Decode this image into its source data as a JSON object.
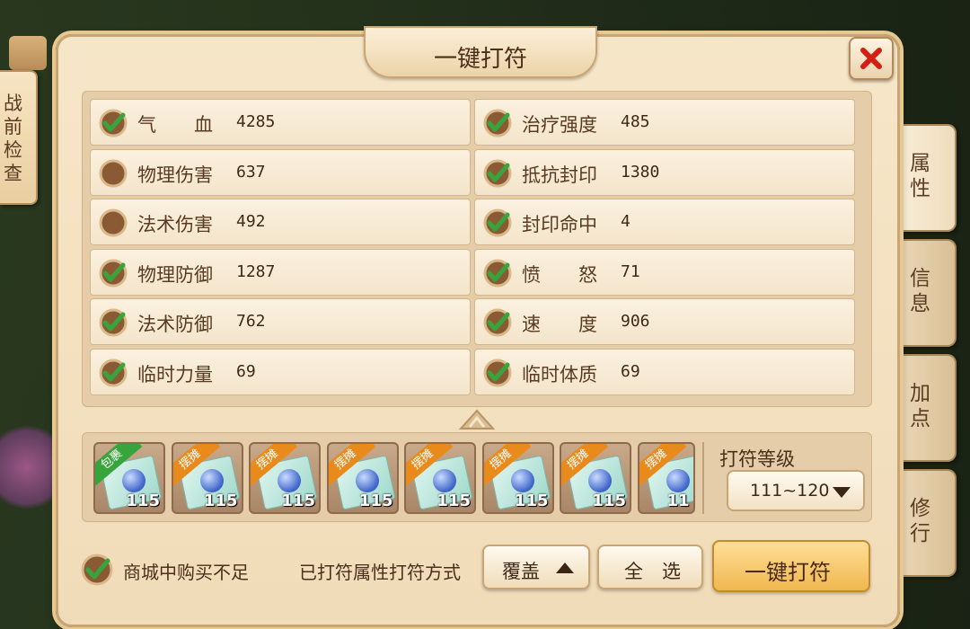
{
  "left_tab": {
    "label": "战前检查"
  },
  "right_tabs": [
    {
      "label": "属性"
    },
    {
      "label": "信息"
    },
    {
      "label": "加点"
    },
    {
      "label": "修行"
    }
  ],
  "dialog": {
    "title": "一键打符",
    "close_icon": "close-x-icon"
  },
  "attributes": {
    "left": [
      {
        "name": "气　　血",
        "value": "4285",
        "checked": true
      },
      {
        "name": "物理伤害",
        "value": "637",
        "checked": false
      },
      {
        "name": "法术伤害",
        "value": "492",
        "checked": false
      },
      {
        "name": "物理防御",
        "value": "1287",
        "checked": true
      },
      {
        "name": "法术防御",
        "value": "762",
        "checked": true
      },
      {
        "name": "临时力量",
        "value": "69",
        "checked": true
      }
    ],
    "right": [
      {
        "name": "治疗强度",
        "value": "485",
        "checked": true
      },
      {
        "name": "抵抗封印",
        "value": "1380",
        "checked": true
      },
      {
        "name": "封印命中",
        "value": "4",
        "checked": true
      },
      {
        "name": "愤　　怒",
        "value": "71",
        "checked": true
      },
      {
        "name": "速　　度",
        "value": "906",
        "checked": true
      },
      {
        "name": "临时体质",
        "value": "69",
        "checked": true
      }
    ]
  },
  "items": [
    {
      "tag": "包裹",
      "tag_color": "#37a53b",
      "level": "115"
    },
    {
      "tag": "摆摊",
      "tag_color": "#e98a1c",
      "level": "115"
    },
    {
      "tag": "摆摊",
      "tag_color": "#e98a1c",
      "level": "115"
    },
    {
      "tag": "摆摊",
      "tag_color": "#e98a1c",
      "level": "115"
    },
    {
      "tag": "摆摊",
      "tag_color": "#e98a1c",
      "level": "115"
    },
    {
      "tag": "摆摊",
      "tag_color": "#e98a1c",
      "level": "115"
    },
    {
      "tag": "摆摊",
      "tag_color": "#e98a1c",
      "level": "115"
    },
    {
      "tag": "摆摊",
      "tag_color": "#e98a1c",
      "level": "11"
    }
  ],
  "level": {
    "label": "打符等级",
    "selected": "111~120"
  },
  "bottom": {
    "shop_checkbox_label": "商城中购买不足",
    "shop_checkbox_checked": true,
    "method_label": "已打符属性打符方式",
    "cover_button": "覆盖",
    "select_all_button": "全　选",
    "main_button": "一键打符"
  },
  "colors": {
    "check_green": "#37a53b",
    "unchecked_brown": "#8a5a34"
  }
}
